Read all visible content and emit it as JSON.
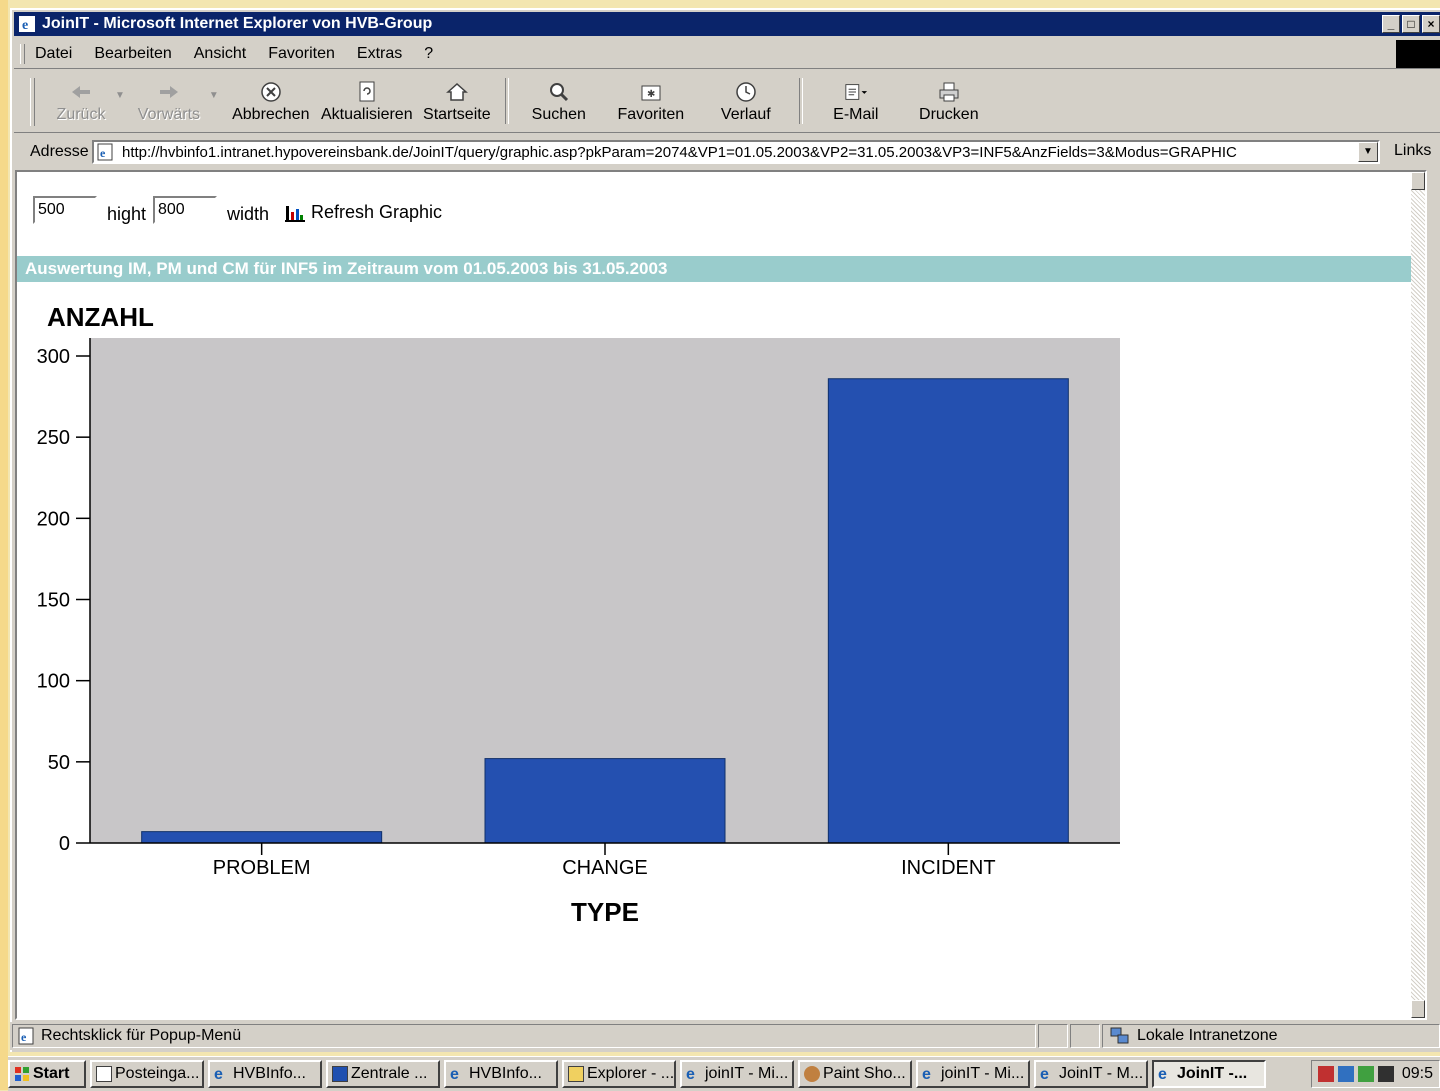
{
  "window": {
    "title": "JoinIT - Microsoft Internet Explorer von HVB-Group",
    "controls": [
      "_",
      "□",
      "×"
    ]
  },
  "menu": [
    "Datei",
    "Bearbeiten",
    "Ansicht",
    "Favoriten",
    "Extras",
    "?"
  ],
  "toolbar": {
    "back": "Zurück",
    "forward": "Vorwärts",
    "stop": "Abbrechen",
    "refresh": "Aktualisieren",
    "home": "Startseite",
    "search": "Suchen",
    "favorites": "Favoriten",
    "history": "Verlauf",
    "mail": "E-Mail",
    "print": "Drucken"
  },
  "address": {
    "label": "Adresse",
    "url": "http://hvbinfo1.intranet.hypovereinsbank.de/JoinIT/query/graphic.asp?pkParam=2074&VP1=01.05.2003&VP2=31.05.2003&VP3=INF5&AnzFields=3&Modus=GRAPHIC",
    "links": "Links"
  },
  "controls": {
    "height_value": "500",
    "height_label": "hight",
    "width_value": "800",
    "width_label": "width",
    "refresh_label": "Refresh Graphic"
  },
  "banner": "Auswertung IM, PM und CM für INF5 im Zeitraum vom 01.05.2003 bis 31.05.2003",
  "chart_data": {
    "type": "bar",
    "title": "ANZAHL",
    "xlabel": "TYPE",
    "ylabel": "ANZAHL",
    "categories": [
      "PROBLEM",
      "CHANGE",
      "INCIDENT"
    ],
    "values": [
      7,
      52,
      286
    ],
    "ylim": [
      0,
      300
    ],
    "yticks": [
      0,
      50,
      100,
      150,
      200,
      250,
      300
    ],
    "bar_color": "#2450b0",
    "plot_bg": "#c8c6c8",
    "grid": false
  },
  "status": {
    "text": "Rechtsklick für Popup-Menü",
    "zone": "Lokale Intranetzone"
  },
  "taskbar": {
    "start": "Start",
    "tasks": [
      "Posteinga...",
      "HVBInfo...",
      "Zentrale ...",
      "HVBInfo...",
      "Explorer - ...",
      "joinIT - Mi...",
      "Paint Sho...",
      "joinIT - Mi...",
      "JoinIT - M...",
      "JoinIT -..."
    ],
    "clock": "09:5"
  }
}
